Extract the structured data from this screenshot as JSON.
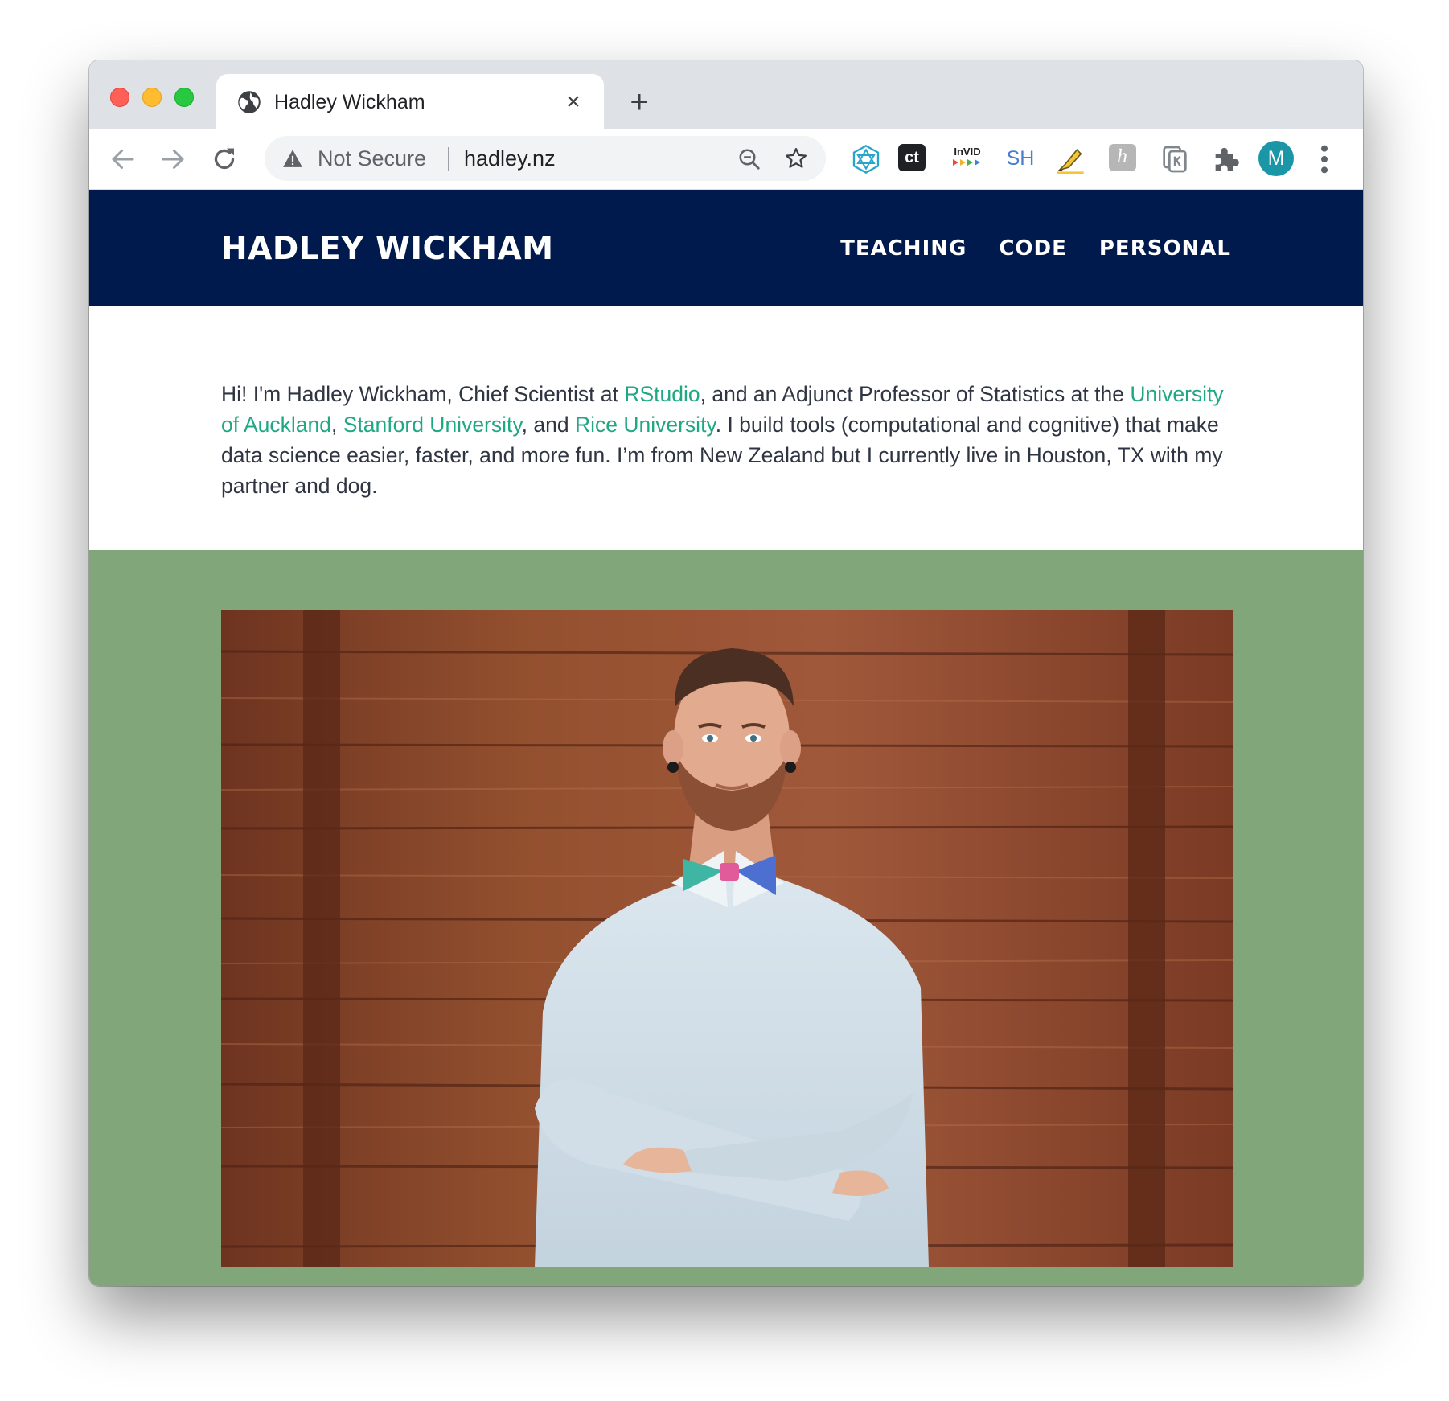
{
  "browser": {
    "tab": {
      "title": "Hadley Wickham",
      "close_glyph": "×",
      "icon": "globe-icon"
    },
    "new_tab_glyph": "+",
    "omnibox": {
      "security_label": "Not Secure",
      "url": "hadley.nz"
    },
    "extensions": {
      "ct_label": "ct",
      "invid_label": "InVID",
      "sh_label": "SH",
      "h_label": "h"
    },
    "profile_initial": "M"
  },
  "site": {
    "title": "HADLEY WICKHAM",
    "nav": [
      {
        "label": "TEACHING"
      },
      {
        "label": "CODE"
      },
      {
        "label": "PERSONAL"
      }
    ],
    "intro": {
      "t1": "Hi! I'm Hadley Wickham, Chief Scientist at ",
      "link_rstudio": "RStudio",
      "t2": ", and an Adjunct Professor of Statistics at the ",
      "link_auckland": "University of Auckland",
      "t3": ", ",
      "link_stanford": "Stanford University",
      "t4": ", and ",
      "link_rice": "Rice University",
      "t5": ". I build tools (computational and cognitive) that make data science easier, faster, and more fun. I’m from New Zealand but I currently live in Houston, TX with my partner and dog."
    },
    "colors": {
      "header_bg": "#001a4d",
      "link": "#1fa883",
      "photo_band_bg": "#81a679"
    }
  }
}
